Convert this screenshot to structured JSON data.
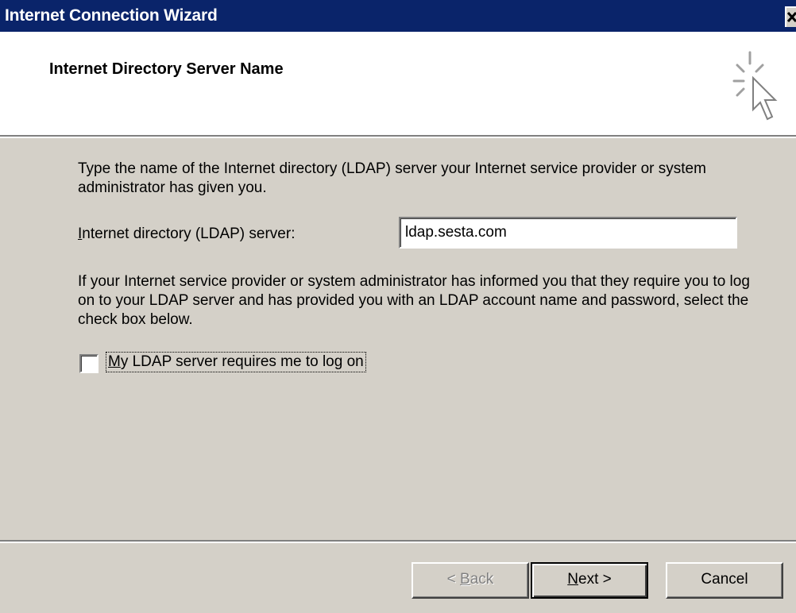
{
  "window": {
    "title": "Internet Connection Wizard",
    "close_icon": "close-icon"
  },
  "header": {
    "heading": "Internet Directory Server Name",
    "icon": "wizard-cursor-icon"
  },
  "body": {
    "intro": "Type the name of the Internet directory (LDAP) server your Internet service provider or system administrator has given you.",
    "server_label_accel": "I",
    "server_label_rest": "nternet directory (LDAP) server:",
    "server_value": "ldap.sesta.com",
    "info": "If your Internet service provider or system administrator has informed you that they require you to log on to your LDAP server and has provided you with an LDAP account name and password, select the check box below.",
    "checkbox_label_accel": "M",
    "checkbox_label_rest": "y LDAP server requires me to log on",
    "checkbox_checked": false
  },
  "buttons": {
    "back_pre": "< ",
    "back_accel": "B",
    "back_rest": "ack",
    "next_accel": "N",
    "next_rest": "ext >",
    "cancel": "Cancel"
  },
  "colors": {
    "titlebar": "#0a246a",
    "face": "#d4d0c8",
    "header_bg": "#ffffff"
  }
}
